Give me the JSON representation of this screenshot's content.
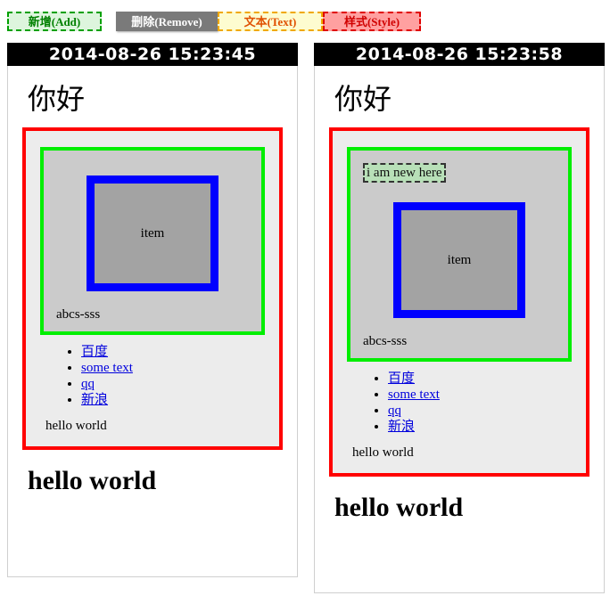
{
  "toolbar": {
    "buttons": [
      {
        "id": "add",
        "label": "新增(Add)"
      },
      {
        "id": "remove",
        "label": "删除(Remove)"
      },
      {
        "id": "text",
        "label": "文本(Text)"
      },
      {
        "id": "style",
        "label": "样式(Style)"
      }
    ],
    "colors": {
      "add_bg": "#ddf5dd",
      "add_border": "#00a000",
      "add_text": "#008000",
      "remove_bg": "#7a7a7a",
      "remove_text": "#ffffff",
      "text_bg": "#fdfcd0",
      "text_border": "#f0a800",
      "text_color": "#e05000",
      "style_bg": "#ffa0a0",
      "style_border": "#e00000",
      "style_text": "#d00000"
    }
  },
  "panels": [
    {
      "id": "left",
      "timestamp": "2014-08-26 15:23:45",
      "greeting": "你好",
      "new_node": null,
      "item_label": "item",
      "abcs_label": "abcs-sss",
      "links": [
        "百度",
        "some text",
        "qq",
        "新浪"
      ],
      "hello_text": "hello world",
      "hello_heading": "hello world",
      "box_colors": {
        "outer_border": "#ff0000",
        "outer_bg": "#ececec",
        "mid_border": "#00ee00",
        "mid_bg": "#cbcbcb",
        "inner_border": "#0000ff",
        "inner_bg": "#a3a3a3"
      }
    },
    {
      "id": "right",
      "timestamp": "2014-08-26 15:23:58",
      "greeting": "你好",
      "new_node": "i am new here",
      "item_label": "item",
      "abcs_label": "abcs-sss",
      "links": [
        "百度",
        "some text",
        "qq",
        "新浪"
      ],
      "hello_text": "hello world",
      "hello_heading": "hello world",
      "box_colors": {
        "outer_border": "#ff0000",
        "outer_bg": "#ececec",
        "mid_border": "#00ee00",
        "mid_bg": "#cbcbcb",
        "inner_border": "#0000ff",
        "inner_bg": "#a3a3a3"
      }
    }
  ]
}
